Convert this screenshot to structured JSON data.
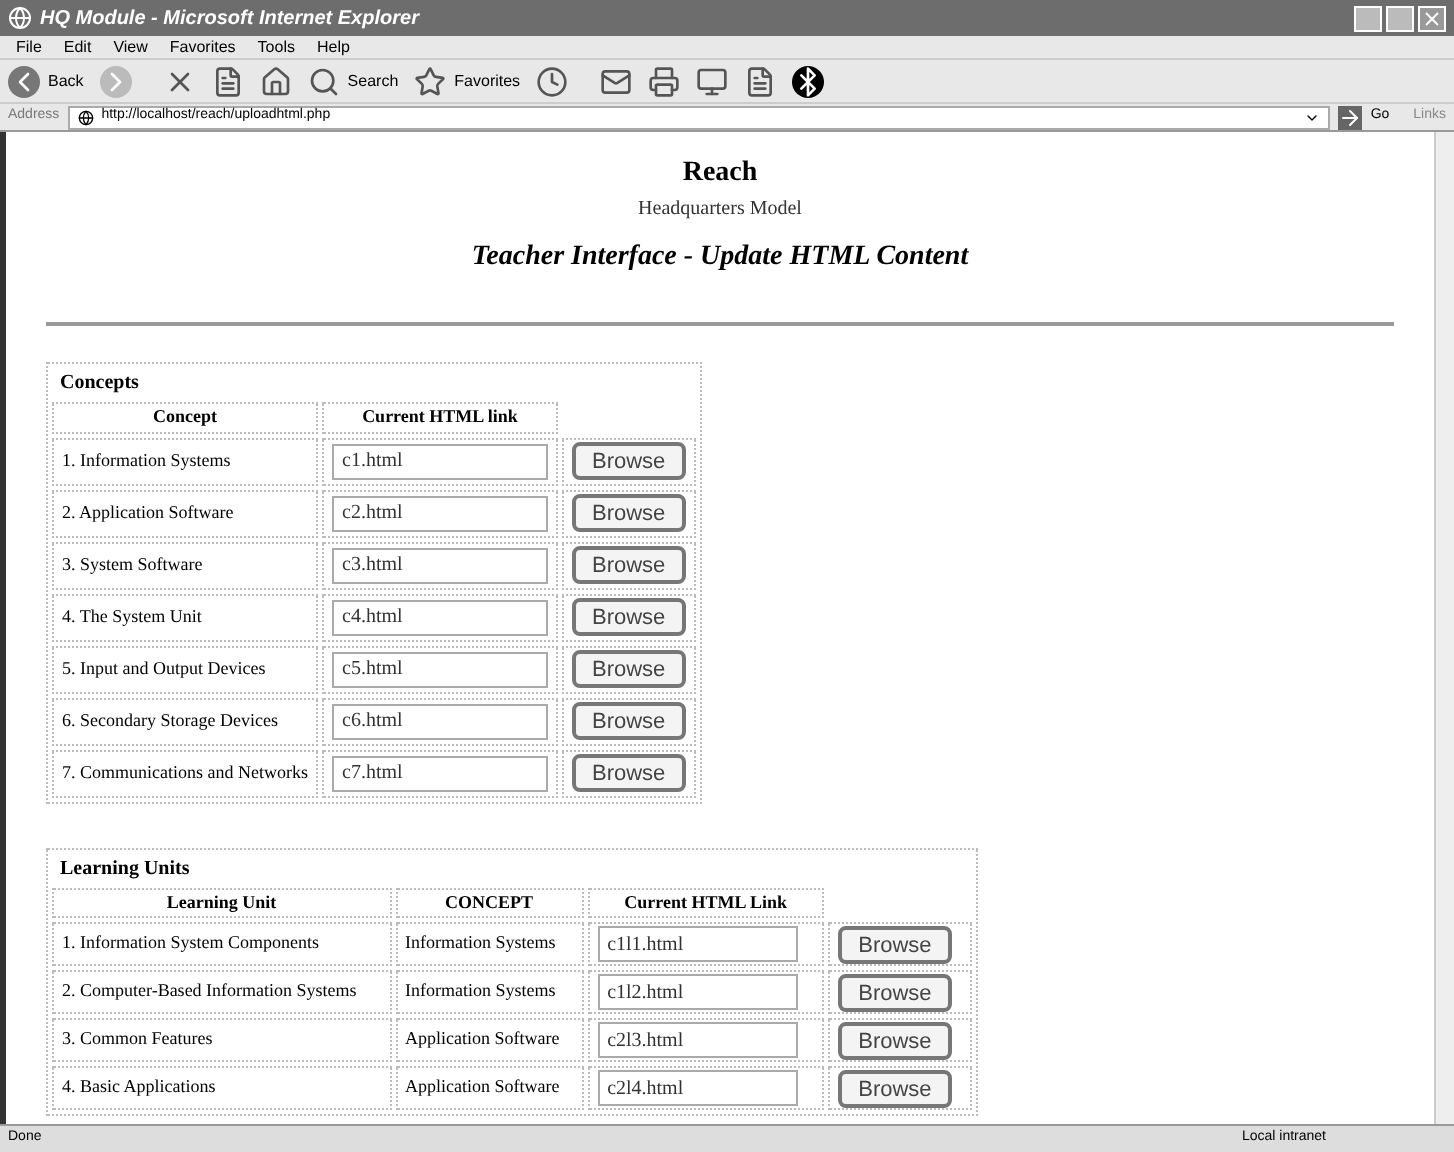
{
  "window": {
    "title": "HQ Module - Microsoft Internet Explorer"
  },
  "menu": [
    "File",
    "Edit",
    "View",
    "Favorites",
    "Tools",
    "Help"
  ],
  "toolbar": {
    "back": "Back",
    "search": "Search",
    "favorites": "Favorites"
  },
  "address": {
    "label": "Address",
    "url": "http://localhost/reach/uploadhtml.php",
    "go": "Go",
    "links": "Links"
  },
  "page": {
    "title": "Reach",
    "subtitle": "Headquarters Model",
    "heading": "Teacher Interface - Update HTML Content"
  },
  "concepts": {
    "caption": "Concepts",
    "columns": [
      "Concept",
      "Current HTML link"
    ],
    "rows": [
      {
        "name": "1. Information Systems",
        "link": "c1.html",
        "button": "Browse"
      },
      {
        "name": "2. Application Software",
        "link": "c2.html",
        "button": "Browse"
      },
      {
        "name": "3. System Software",
        "link": "c3.html",
        "button": "Browse"
      },
      {
        "name": "4. The System Unit",
        "link": "c4.html",
        "button": "Browse"
      },
      {
        "name": "5. Input and Output Devices",
        "link": "c5.html",
        "button": "Browse"
      },
      {
        "name": "6. Secondary Storage Devices",
        "link": "c6.html",
        "button": "Browse"
      },
      {
        "name": "7. Communications and Networks",
        "link": "c7.html",
        "button": "Browse"
      }
    ]
  },
  "learning_units": {
    "caption": "Learning Units",
    "columns": [
      "Learning Unit",
      "CONCEPT",
      "Current HTML Link"
    ],
    "rows": [
      {
        "name": "1. Information System Components",
        "concept": "Information Systems",
        "link": "c1l1.html",
        "button": "Browse"
      },
      {
        "name": "2. Computer-Based Information Systems",
        "concept": "Information Systems",
        "link": "c1l2.html",
        "button": "Browse"
      },
      {
        "name": "3. Common Features",
        "concept": "Application Software",
        "link": "c2l3.html",
        "button": "Browse"
      },
      {
        "name": "4. Basic Applications",
        "concept": "Application Software",
        "link": "c2l4.html",
        "button": "Browse"
      }
    ]
  },
  "status_bar": {
    "text": "Done",
    "zone": "Local intranet"
  }
}
